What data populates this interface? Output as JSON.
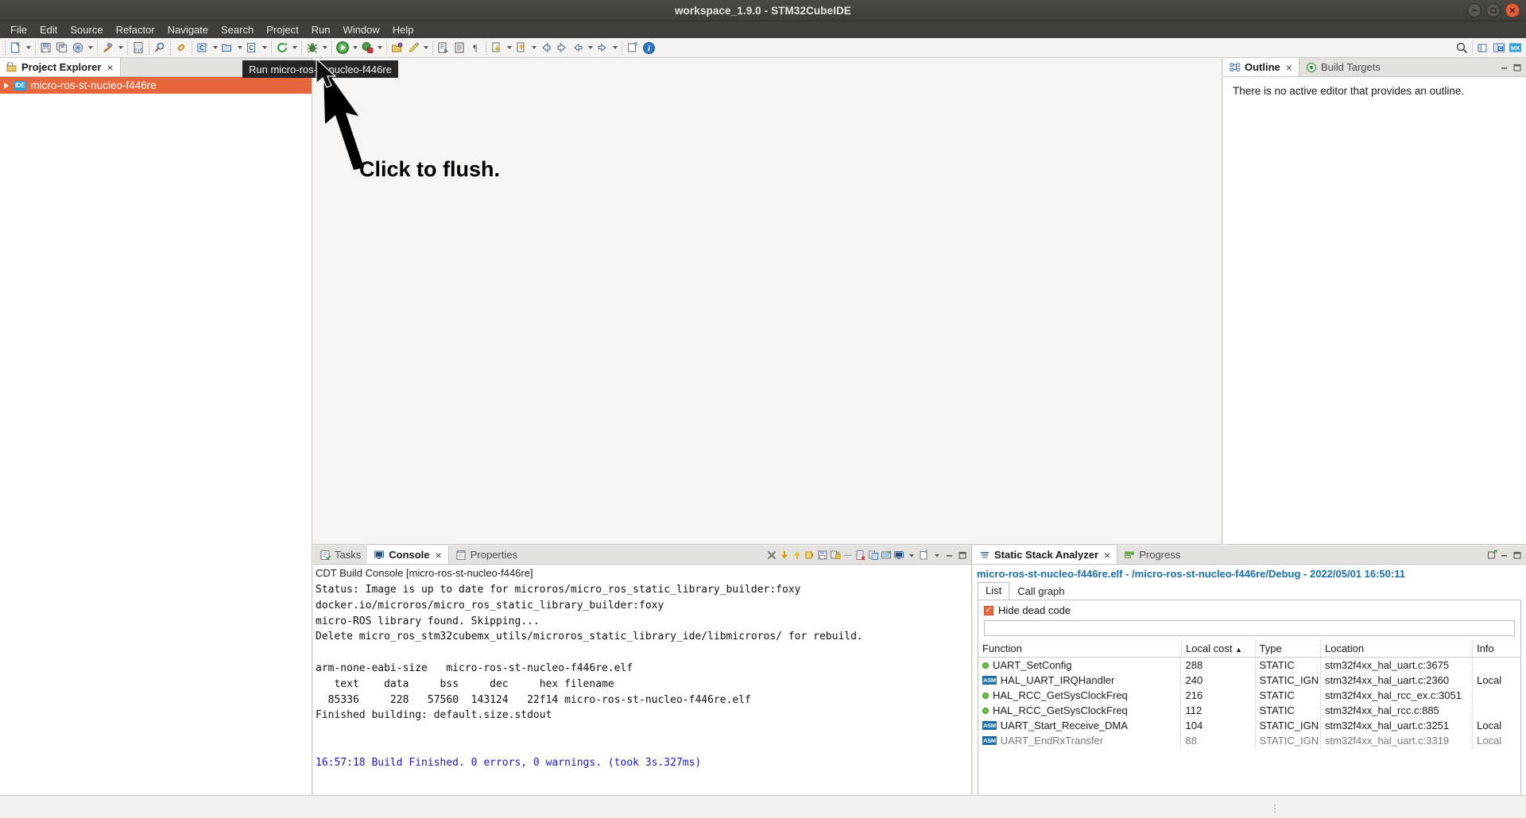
{
  "window": {
    "title": "workspace_1.9.0 - STM32CubeIDE",
    "controls": [
      {
        "name": "minimize-button",
        "glyph": "minimize"
      },
      {
        "name": "maximize-button",
        "glyph": "maximize"
      },
      {
        "name": "close-button",
        "glyph": "close"
      }
    ]
  },
  "menubar": {
    "items": [
      {
        "label": "File"
      },
      {
        "label": "Edit"
      },
      {
        "label": "Source"
      },
      {
        "label": "Refactor"
      },
      {
        "label": "Navigate"
      },
      {
        "label": "Search"
      },
      {
        "label": "Project"
      },
      {
        "label": "Run"
      },
      {
        "label": "Window"
      },
      {
        "label": "Help"
      }
    ]
  },
  "toolbar": {
    "left_icons": [
      "new-file-icon",
      "dropdown",
      "sep",
      "save-icon",
      "save-all-icon",
      "print-icon",
      "dropdown",
      "sep",
      "build-hammer-icon",
      "dropdown",
      "sep",
      "binary-010-icon",
      "sep",
      "search-icon",
      "sep",
      "link-icon",
      "sep",
      "new-c-project-icon",
      "dropdown",
      "new-c-folder-icon",
      "dropdown",
      "new-c-file-icon",
      "dropdown",
      "sep",
      "refresh-green-icon",
      "dropdown",
      "sep",
      "debug-bug-icon",
      "dropdown",
      "sep",
      "run-play-icon",
      "dropdown",
      "run-stop-icon",
      "dropdown",
      "sep",
      "open-perspective-icon",
      "skip-all-breakpoints-icon",
      "dropdown",
      "sep",
      "external-tools-icon",
      "open-type-icon",
      "pilcrow-icon",
      "sep",
      "next-annotation-icon",
      "dropdown",
      "prev-annotation-icon",
      "dropdown",
      "back-icon",
      "forward-icon",
      "back-nav-icon",
      "dropdown",
      "forward-nav-icon",
      "dropdown",
      "sep",
      "restore-view-icon",
      "info-icon"
    ],
    "right_icons": [
      "search-magnifier-icon",
      "sep",
      "open-perspective-icon",
      "c-cpp-perspective-icon",
      "mx-perspective-icon"
    ]
  },
  "tooltip": {
    "text": "Run micro-ros-st-nucleo-f446re"
  },
  "annotation": {
    "text": "Click to flush."
  },
  "project_explorer": {
    "tab_label": "Project Explorer",
    "tab_icon": "project-explorer-icon",
    "close_glyph": "×",
    "tools": [
      "collapse-all-icon",
      "link-with-editor-icon"
    ],
    "tree": [
      {
        "label": "micro-ros-st-nucleo-f446re",
        "badge": "IDE",
        "expanded": false,
        "selected": true
      }
    ]
  },
  "outline": {
    "tabs": [
      {
        "label": "Outline",
        "icon": "outline-icon",
        "active": true,
        "closable": true
      },
      {
        "label": "Build Targets",
        "icon": "build-targets-icon",
        "active": false,
        "closable": false
      }
    ],
    "close_glyph": "×",
    "empty_message": "There is no active editor that provides an outline.",
    "tools": [
      "minimize-icon",
      "maximize-icon"
    ]
  },
  "console": {
    "tabs": [
      {
        "label": "Tasks",
        "icon": "tasks-icon",
        "active": false,
        "closable": false
      },
      {
        "label": "Console",
        "icon": "console-icon",
        "active": true,
        "closable": true
      },
      {
        "label": "Properties",
        "icon": "properties-icon",
        "active": false,
        "closable": false
      }
    ],
    "close_glyph": "×",
    "tools": [
      "clear-console-icon",
      "scroll-down-icon",
      "scroll-up-icon",
      "scroll-lock-icon",
      "save-console-icon",
      "pin-console-icon",
      "separator",
      "remove-console-icon",
      "remove-all-consoles-icon",
      "open-console-icon",
      "display-console-icon",
      "dropdown",
      "new-console-view-icon",
      "dropdown",
      "minimize-icon",
      "maximize-icon"
    ],
    "subheader": "CDT Build Console [micro-ros-st-nucleo-f446re]",
    "lines": [
      {
        "text": "Status: Image is up to date for microros/micro_ros_static_library_builder:foxy",
        "color": "black"
      },
      {
        "text": "docker.io/microros/micro_ros_static_library_builder:foxy",
        "color": "black"
      },
      {
        "text": "micro-ROS library found. Skipping...",
        "color": "black"
      },
      {
        "text": "Delete micro_ros_stm32cubemx_utils/microros_static_library_ide/libmicroros/ for rebuild.",
        "color": "black"
      },
      {
        "text": "",
        "color": "black"
      },
      {
        "text": "arm-none-eabi-size   micro-ros-st-nucleo-f446re.elf",
        "color": "black"
      },
      {
        "text": "   text\t   data\t    bss\t    dec\t    hex\tfilename",
        "color": "black"
      },
      {
        "text": "  85336\t    228\t  57560\t 143124\t  22f14\tmicro-ros-st-nucleo-f446re.elf",
        "color": "black"
      },
      {
        "text": "Finished building: default.size.stdout",
        "color": "black"
      },
      {
        "text": "",
        "color": "black"
      },
      {
        "text": "",
        "color": "black"
      },
      {
        "text": "16:57:18 Build Finished. 0 errors, 0 warnings. (took 3s.327ms)",
        "color": "blue"
      }
    ],
    "blue_color": "#1818c8"
  },
  "static_stack_analyzer": {
    "tabs": [
      {
        "label": "Static Stack Analyzer",
        "icon": "stack-analyzer-icon",
        "active": true,
        "closable": true
      },
      {
        "label": "Progress",
        "icon": "progress-icon",
        "active": false,
        "closable": false
      }
    ],
    "close_glyph": "×",
    "tools": [
      "detach-icon",
      "minimize-icon",
      "maximize-icon"
    ],
    "path_line": "micro-ros-st-nucleo-f446re.elf - /micro-ros-st-nucleo-f446re/Debug - 2022/05/01 16:50:11",
    "path_color": "#1a6fa8",
    "subtabs": [
      {
        "label": "List",
        "active": true
      },
      {
        "label": "Call graph",
        "active": false
      }
    ],
    "hide_dead_code": {
      "label": "Hide dead code",
      "checked": true
    },
    "filter_value": "",
    "columns": [
      {
        "label": "Function",
        "sorted": false
      },
      {
        "label": "Local cost",
        "sorted": true,
        "sort_glyph": "▲"
      },
      {
        "label": "Type",
        "sorted": false
      },
      {
        "label": "Location",
        "sorted": false
      },
      {
        "label": "Info",
        "sorted": false
      }
    ],
    "rows": [
      {
        "icon": "static-dot-icon",
        "function": "UART_SetConfig",
        "local_cost": "288",
        "type": "STATIC",
        "location": "stm32f4xx_hal_uart.c:3675",
        "info": ""
      },
      {
        "icon": "asm-badge-icon",
        "function": "HAL_UART_IRQHandler",
        "local_cost": "240",
        "type": "STATIC_IGN",
        "location": "stm32f4xx_hal_uart.c:2360",
        "info": "Local"
      },
      {
        "icon": "static-dot-icon",
        "function": "HAL_RCC_GetSysClockFreq",
        "local_cost": "216",
        "type": "STATIC",
        "location": "stm32f4xx_hal_rcc_ex.c:3051",
        "info": ""
      },
      {
        "icon": "static-dot-icon",
        "function": "HAL_RCC_GetSysClockFreq",
        "local_cost": "112",
        "type": "STATIC",
        "location": "stm32f4xx_hal_rcc.c:885",
        "info": ""
      },
      {
        "icon": "asm-badge-icon",
        "function": "UART_Start_Receive_DMA",
        "local_cost": "104",
        "type": "STATIC_IGN",
        "location": "stm32f4xx_hal_uart.c:3251",
        "info": "Local"
      },
      {
        "icon": "asm-badge-icon",
        "function": "UART_EndRxTransfer",
        "local_cost": "88",
        "type": "STATIC_IGN",
        "location": "stm32f4xx_hal_uart.c:3319",
        "info": "Local"
      }
    ]
  },
  "colors": {
    "selection_orange": "#e8663c",
    "titlebar": "#413f3b",
    "link_blue": "#1a6fa8"
  }
}
